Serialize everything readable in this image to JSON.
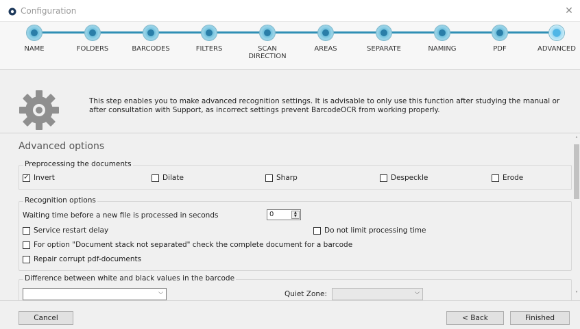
{
  "window": {
    "title": "Configuration",
    "close_glyph": "✕"
  },
  "steps": [
    {
      "label": "NAME",
      "active": false
    },
    {
      "label": "FOLDERS",
      "active": false
    },
    {
      "label": "BARCODES",
      "active": false
    },
    {
      "label": "FILTERS",
      "active": false
    },
    {
      "label": "SCAN DIRECTION",
      "active": false
    },
    {
      "label": "AREAS",
      "active": false
    },
    {
      "label": "SEPARATE",
      "active": false
    },
    {
      "label": "NAMING",
      "active": false
    },
    {
      "label": "PDF",
      "active": false
    },
    {
      "label": "ADVANCED",
      "active": true
    }
  ],
  "info": {
    "icon": "gear-icon",
    "text": "This step enables you to make advanced recognition settings. It is advisable to only use this function after studying the manual or after consultation with Support, as incorrect settings prevent BarcodeOCR from working properly."
  },
  "advanced": {
    "title": "Advanced options",
    "preprocessing": {
      "title": "Preprocessing the documents",
      "options": [
        {
          "label": "Invert",
          "checked": true
        },
        {
          "label": "Dilate",
          "checked": false
        },
        {
          "label": "Sharp",
          "checked": false
        },
        {
          "label": "Despeckle",
          "checked": false
        },
        {
          "label": "Erode",
          "checked": false
        }
      ]
    },
    "recognition": {
      "title": "Recognition options",
      "wait_label": "Waiting time before a new file is processed in seconds",
      "wait_value": "0",
      "service_restart": {
        "label": "Service restart delay",
        "checked": false
      },
      "no_limit": {
        "label": "Do not limit processing time",
        "checked": false
      },
      "stack_check": {
        "label": "For option \"Document stack not separated\" check the complete document for a barcode",
        "checked": false
      },
      "repair_pdf": {
        "label": "Repair corrupt pdf-documents",
        "checked": false
      }
    },
    "difference": {
      "title": "Difference between white and black values in the barcode",
      "value": "",
      "quiet_zone_label": "Quiet Zone:",
      "quiet_zone_value": ""
    }
  },
  "footer": {
    "cancel": "Cancel",
    "back": "< Back",
    "finished": "Finished"
  },
  "colors": {
    "accent": "#2f8fb5",
    "active_step": "#4fb6e6"
  }
}
